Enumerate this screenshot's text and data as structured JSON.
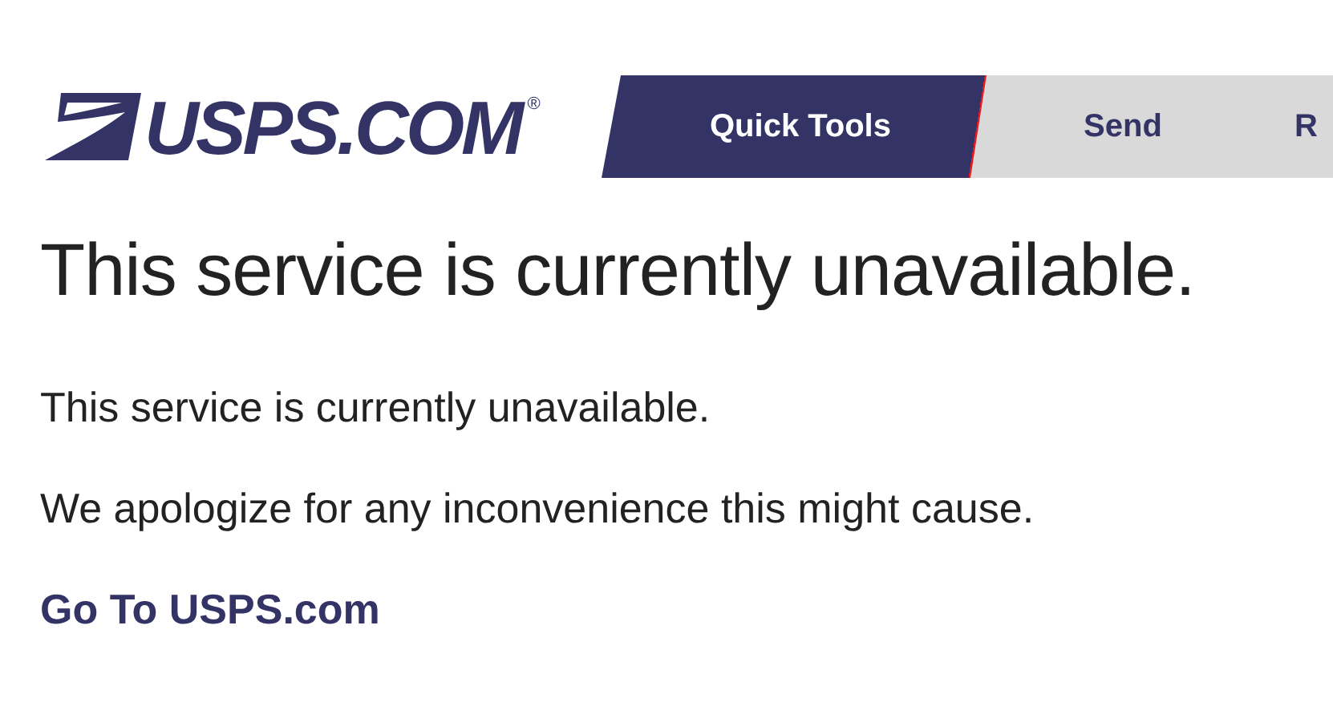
{
  "header": {
    "logo_text": "USPS.COM",
    "logo_mark": "®"
  },
  "nav": [
    {
      "label": "Quick Tools",
      "selected": true
    },
    {
      "label": "Send",
      "selected": false
    },
    {
      "label": "R",
      "selected": false
    }
  ],
  "heading": "This service is currently unavailable.",
  "paragraphs": [
    "This service is currently unavailable.",
    "We apologize for any inconvenience this might cause."
  ],
  "link": "Go To USPS.com"
}
